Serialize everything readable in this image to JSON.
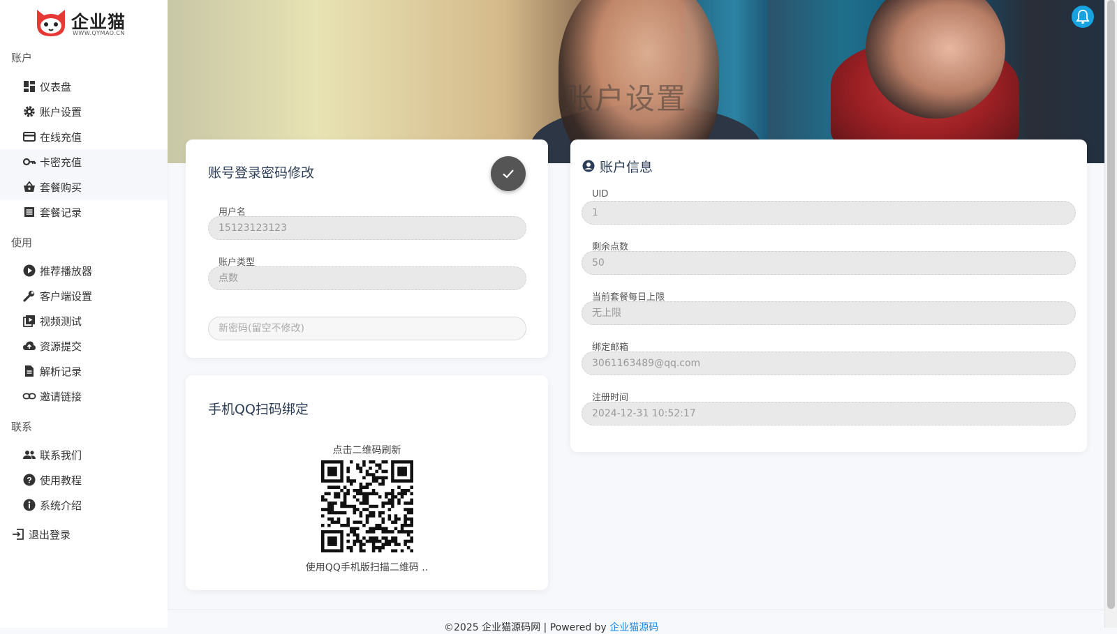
{
  "brand": {
    "name": "企业猫",
    "url": "WWW.QYMAO.CN"
  },
  "sidebar": {
    "sections": [
      {
        "title": "账户",
        "items": [
          {
            "label": "仪表盘",
            "icon": "dashboard-icon"
          },
          {
            "label": "账户设置",
            "icon": "gear-icon"
          },
          {
            "label": "在线充值",
            "icon": "credit-card-icon"
          },
          {
            "label": "卡密充值",
            "icon": "key-icon"
          },
          {
            "label": "套餐购买",
            "icon": "basket-icon"
          },
          {
            "label": "套餐记录",
            "icon": "list-icon"
          }
        ]
      },
      {
        "title": "使用",
        "items": [
          {
            "label": "推荐播放器",
            "icon": "play-circle-icon"
          },
          {
            "label": "客户端设置",
            "icon": "wrench-icon"
          },
          {
            "label": "视频测试",
            "icon": "video-library-icon"
          },
          {
            "label": "资源提交",
            "icon": "cloud-upload-icon"
          },
          {
            "label": "解析记录",
            "icon": "document-icon"
          },
          {
            "label": "邀请链接",
            "icon": "link-icon"
          }
        ]
      },
      {
        "title": "联系",
        "items": [
          {
            "label": "联系我们",
            "icon": "people-icon"
          },
          {
            "label": "使用教程",
            "icon": "help-circle-icon"
          },
          {
            "label": "系统介绍",
            "icon": "info-circle-icon"
          }
        ]
      }
    ],
    "logout": "退出登录"
  },
  "hero": {
    "title": "账户设置"
  },
  "password_card": {
    "title": "账号登录密码修改",
    "username_label": "用户名",
    "username_value": "15123123123",
    "type_label": "账户类型",
    "type_value": "点数",
    "new_password_placeholder": "新密码(留空不修改)"
  },
  "qq_card": {
    "title": "手机QQ扫码绑定",
    "refresh_hint": "点击二维码刷新",
    "scan_hint": "使用QQ手机版扫描二维码 .."
  },
  "account_info": {
    "title": "账户信息",
    "fields": [
      {
        "label": "UID",
        "value": "1"
      },
      {
        "label": "剩余点数",
        "value": "50"
      },
      {
        "label": "当前套餐每日上限",
        "value": "无上限"
      },
      {
        "label": "绑定邮箱",
        "value": "3061163489@qq.com"
      },
      {
        "label": "注册时间",
        "value": "2024-12-31 10:52:17"
      }
    ]
  },
  "footer": {
    "text": "©2025 企业猫源码网 | Powered by ",
    "link": "企业猫源码"
  },
  "colors": {
    "accent": "#1e88e5",
    "bell": "#17a2e0",
    "check_button": "#555555"
  }
}
